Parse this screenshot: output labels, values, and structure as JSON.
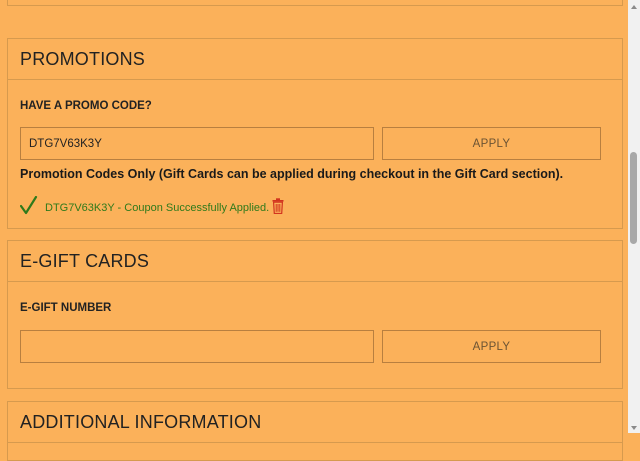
{
  "promotions": {
    "title": "PROMOTIONS",
    "promo_label": "HAVE A PROMO CODE?",
    "promo_value": "DTG7V63K3Y",
    "apply_label": "APPLY",
    "note": "Promotion Codes Only (Gift Cards can be applied during checkout in the Gift Card section).",
    "applied_message": "DTG7V63K3Y - Coupon Successfully Applied.",
    "check_icon": "check-icon",
    "trash_icon": "trash-icon",
    "success_color": "#2f7a1b",
    "trash_color": "#d2341f"
  },
  "egift": {
    "title": "E-GIFT CARDS",
    "number_label": "E-GIFT NUMBER",
    "number_value": "",
    "apply_label": "APPLY"
  },
  "additional": {
    "title": "ADDITIONAL INFORMATION"
  },
  "colors": {
    "background": "#FBB15A",
    "border": "#d69a4e"
  }
}
